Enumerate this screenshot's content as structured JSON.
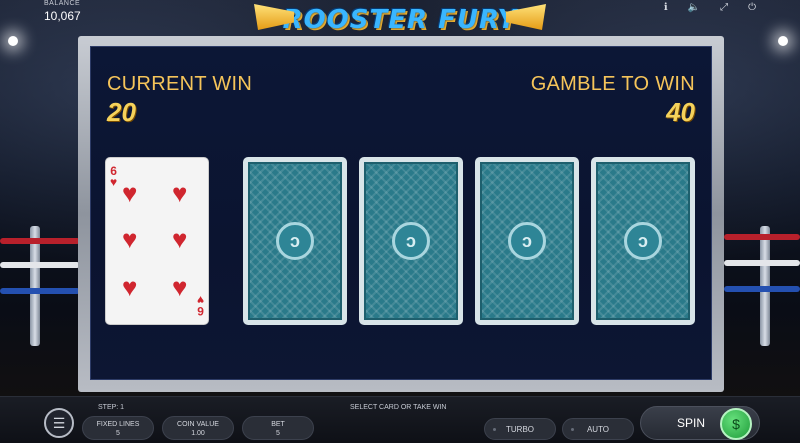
{
  "header": {
    "balance_label": "BALANCE",
    "balance_value": "10,067",
    "logo_text": "ROOSTER FURY",
    "icons": [
      "info-icon",
      "sound-icon",
      "fullscreen-icon",
      "power-icon"
    ]
  },
  "gamble": {
    "current_win_label": "CURRENT WIN",
    "current_win_value": "20",
    "gamble_to_win_label": "GAMBLE TO WIN",
    "gamble_to_win_value": "40",
    "revealed_card": {
      "rank": "6",
      "suit": "hearts",
      "suit_glyph": "♥"
    },
    "hidden_cards_count": 4
  },
  "bottom": {
    "step_label": "STEP: 1",
    "fixed_lines_label": "FIXED LINES",
    "fixed_lines_value": "5",
    "coin_value_label": "COIN VALUE",
    "coin_value_value": "1.00",
    "bet_label": "BET",
    "bet_value": "5",
    "message": "SELECT CARD OR TAKE WIN",
    "turbo_label": "TURBO",
    "auto_label": "AUTO",
    "spin_label": "SPIN"
  },
  "colors": {
    "gold_text": "#f5c45a",
    "card_back": "#2a7a8a",
    "heart_red": "#d0262f",
    "board_bg": "#0c1736"
  }
}
